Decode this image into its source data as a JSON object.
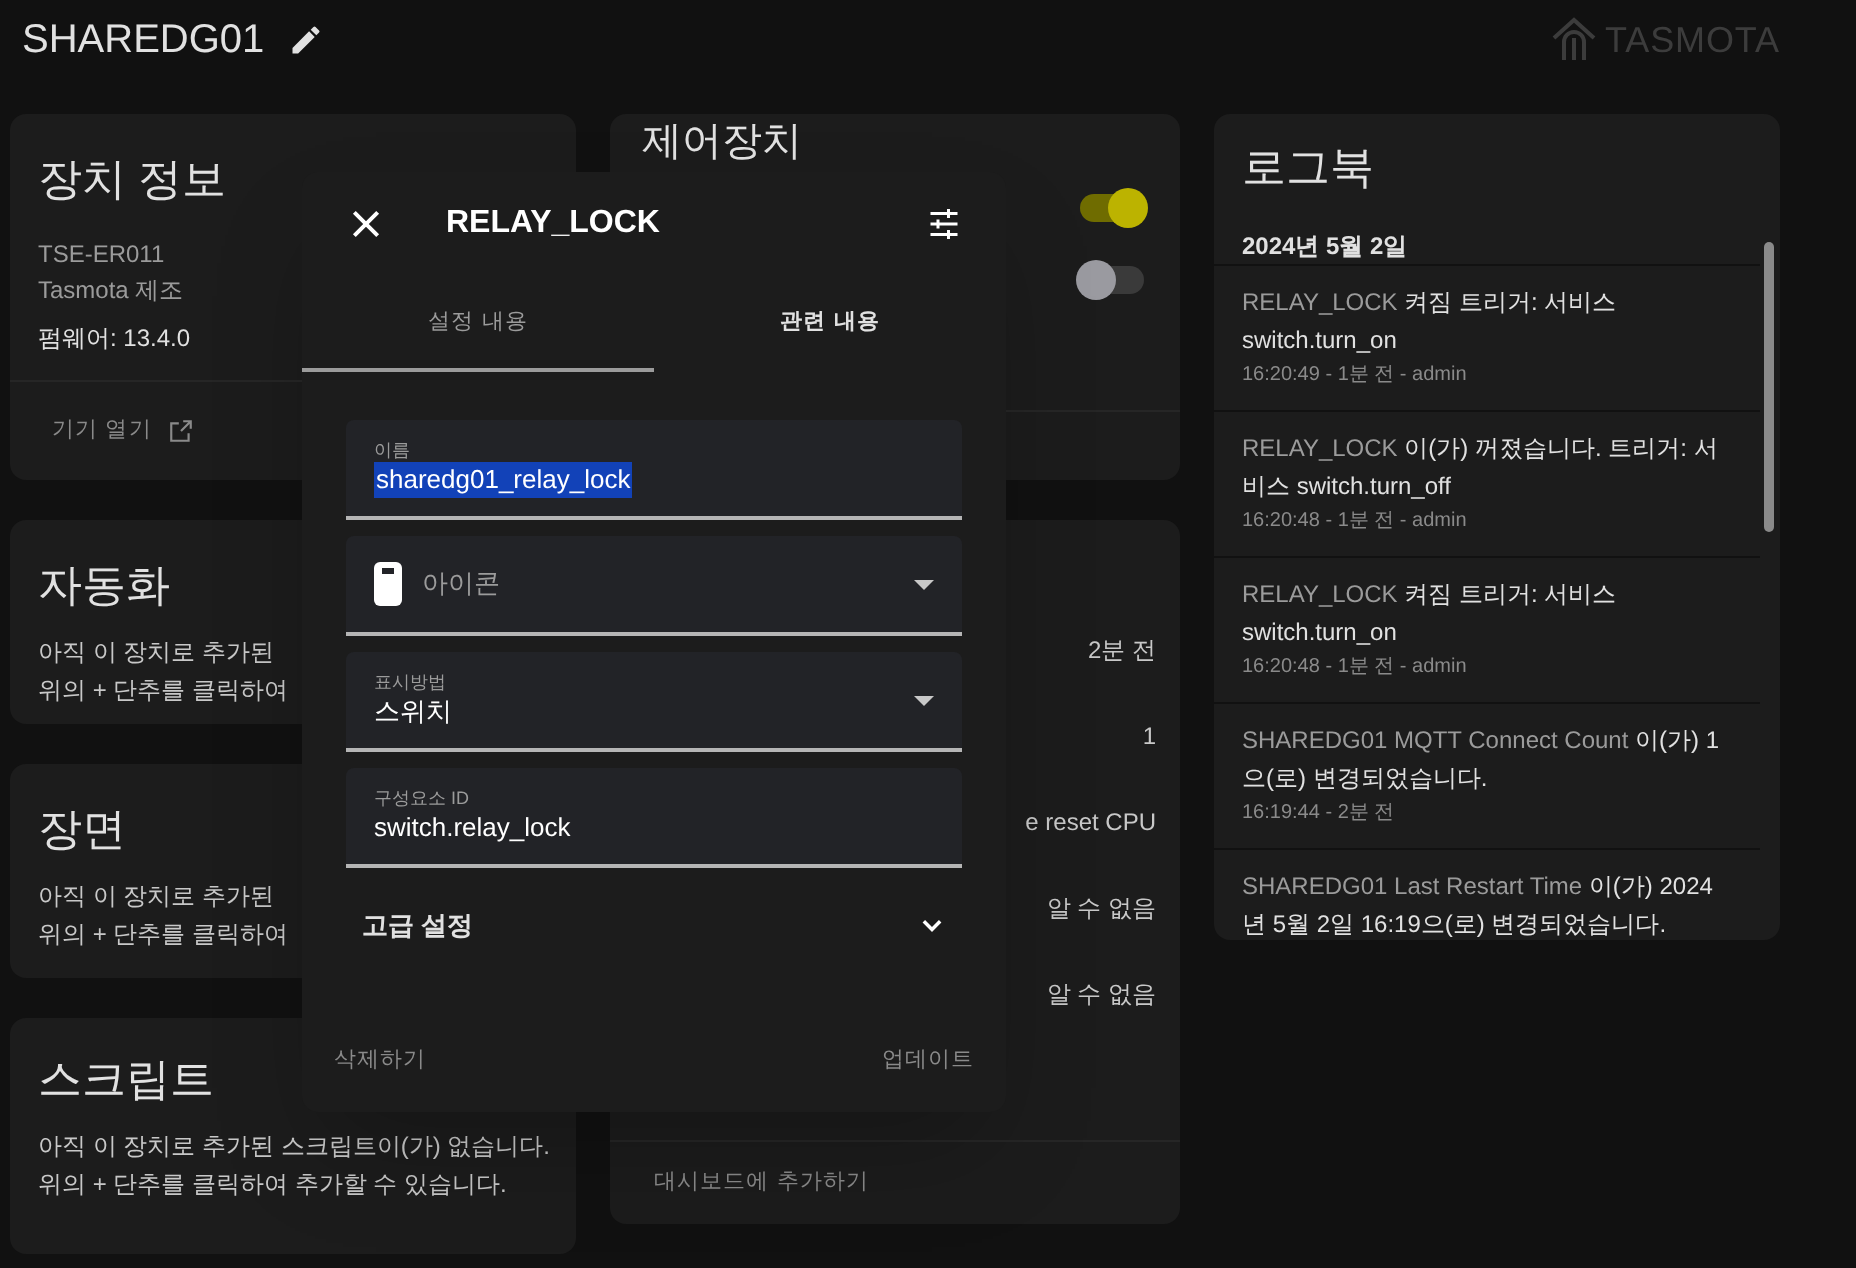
{
  "header": {
    "title": "SHAREDG01",
    "logo": "TASMOTA"
  },
  "device_info": {
    "title": "장치 정보",
    "model": "TSE-ER011",
    "manufacturer": "Tasmota 제조",
    "firmware": "펌웨어: 13.4.0",
    "link": "기기 열기"
  },
  "automation": {
    "title": "자동화",
    "lines": [
      "아직 이 장치로 추가된",
      "위의 + 단추를 클릭하여"
    ]
  },
  "scenes": {
    "title": "장면",
    "lines": [
      "아직 이 장치로 추가된",
      "위의 + 단추를 클릭하여"
    ]
  },
  "scripts": {
    "title": "스크립트",
    "text": "아직 이 장치로 추가된 스크립트이(가) 없습니다. 위의 + 단추를 클릭하여 추가할 수 있습니다."
  },
  "controls": {
    "title": "제어장치",
    "toggles": [
      {
        "on": true
      },
      {
        "on": false
      }
    ]
  },
  "sensors": {
    "values": [
      "2분 전",
      "1",
      "e reset CPU",
      "알 수 없음",
      "알 수 없음"
    ],
    "footer": "대시보드에 추가하기"
  },
  "logbook": {
    "title": "로그북",
    "date": "2024년 5월 2일",
    "entries": [
      {
        "entity": "RELAY_LOCK",
        "message": "켜짐 트리거: 서비스 switch.turn_on",
        "meta": "16:20:49 - 1분 전 - admin"
      },
      {
        "entity": "RELAY_LOCK",
        "message": "이(가) 꺼졌습니다. 트리거: 서비스 switch.turn_off",
        "meta": "16:20:48 - 1분 전 - admin"
      },
      {
        "entity": "RELAY_LOCK",
        "message": "켜짐 트리거: 서비스 switch.turn_on",
        "meta": "16:20:48 - 1분 전 - admin"
      },
      {
        "entity": "SHAREDG01 MQTT Connect Count",
        "message": "이(가) 1으(로) 변경되었습니다.",
        "meta": "16:19:44 - 2분 전"
      },
      {
        "entity": "SHAREDG01 Last Restart Time",
        "message": "이(가) 2024년 5월 2일 16:19으(로) 변경되었습니다."
      }
    ]
  },
  "dialog": {
    "title": "RELAY_LOCK",
    "tabs": [
      {
        "label": "설정 내용",
        "selected": true
      },
      {
        "label": "관련 내용",
        "selected": false
      }
    ],
    "fields": [
      {
        "kind": "text",
        "label": "이름",
        "value": "sharedg01_relay_lock",
        "highlighted": true
      },
      {
        "kind": "icon",
        "placeholder": "아이콘"
      },
      {
        "kind": "select",
        "label": "표시방법",
        "value": "스위치"
      },
      {
        "kind": "text",
        "label": "구성요소 ID",
        "value": "switch.relay_lock",
        "highlighted": false
      }
    ],
    "advanced": {
      "label": "고급 설정",
      "expanded": false
    },
    "buttons": [
      "삭제하기",
      "업데이트"
    ]
  }
}
